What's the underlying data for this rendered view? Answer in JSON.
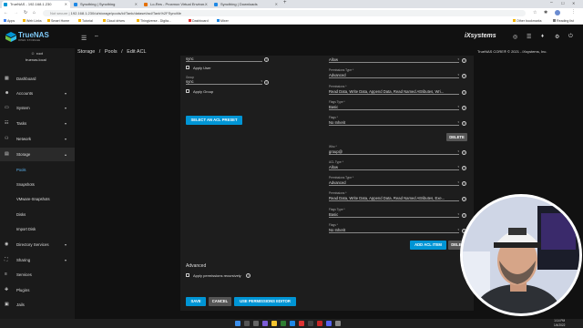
{
  "browser": {
    "tabs": [
      {
        "title": "TrueNAS - 192.168.1.230",
        "color": "#0095d5",
        "active": true
      },
      {
        "title": "Syncthing | Syncthing",
        "color": "#1e88e5",
        "active": false
      },
      {
        "title": "Lo-Res - Proxmox Virtual Environ...",
        "color": "#e57000",
        "active": false
      },
      {
        "title": "Syncthing | Downloads",
        "color": "#1e88e5",
        "active": false
      }
    ],
    "url_prefix": "Not secure",
    "url": "192.168.1.230/ui/storage/pools/id/Tank/dataset/acl/Tank%2FSyncMe",
    "bookmarks": [
      "Apps",
      "Web Links",
      "Smart Home",
      "Tutorial",
      "Cloud drives",
      "Thingiverse - Digita...",
      "Dashboard",
      "Mixer"
    ],
    "bookmarks_right": [
      "Other bookmarks",
      "Reading list"
    ]
  },
  "header": {
    "logo_text": "TrueNAS",
    "logo_sub": "OPEN STORAGE",
    "brand": "iXsystems"
  },
  "breadcrumb": {
    "items": [
      "Storage",
      "Pools",
      "Edit ACL"
    ],
    "separator": "/",
    "copyright": "TrueNAS CORE® © 2021 - iXsystems, Inc."
  },
  "sidebar": {
    "user": "root",
    "host": "truenas.local",
    "items": [
      {
        "label": "Dashboard",
        "icon": "dashboard-icon",
        "glyph": "▦",
        "chev": ""
      },
      {
        "label": "Accounts",
        "icon": "accounts-icon",
        "glyph": "☻",
        "chev": "▾"
      },
      {
        "label": "System",
        "icon": "system-icon",
        "glyph": "▭",
        "chev": "▾"
      },
      {
        "label": "Tasks",
        "icon": "tasks-icon",
        "glyph": "☷",
        "chev": "▾"
      },
      {
        "label": "Network",
        "icon": "network-icon",
        "glyph": "⚇",
        "chev": "▾"
      },
      {
        "label": "Storage",
        "icon": "storage-icon",
        "glyph": "▤",
        "chev": "▴"
      }
    ],
    "storage_sub": [
      "Pools",
      "Snapshots",
      "VMware-Snapshots",
      "Disks",
      "Import Disk"
    ],
    "items_after": [
      {
        "label": "Directory Services",
        "icon": "directory-services-icon",
        "glyph": "◉",
        "chev": "▾"
      },
      {
        "label": "Sharing",
        "icon": "sharing-icon",
        "glyph": "⛶",
        "chev": "▾"
      },
      {
        "label": "Services",
        "icon": "services-icon",
        "glyph": "≡",
        "chev": ""
      },
      {
        "label": "Plugins",
        "icon": "plugins-icon",
        "glyph": "✚",
        "chev": ""
      },
      {
        "label": "Jails",
        "icon": "jails-icon",
        "glyph": "▣",
        "chev": ""
      }
    ]
  },
  "form": {
    "left": {
      "user_value": "sync",
      "apply_user": "Apply User",
      "group_label": "Group",
      "group_value": "sync",
      "apply_group": "Apply Group",
      "select_preset": "SELECT AN ACL PRESET"
    },
    "entry1": {
      "type_value": "Allow",
      "perm_type_label": "Permissions Type *",
      "perm_type_value": "Advanced",
      "perms_label": "Permissions *",
      "perms_value": "Read Data, Write Data, Append Data, Read Named Attributes, Wri...",
      "flags_type_label": "Flags Type *",
      "flags_type_value": "Basic",
      "flags_label": "Flags *",
      "flags_value": "No Inherit",
      "delete": "DELETE"
    },
    "entry2": {
      "who_label": "Who *",
      "who_value": "group@",
      "acl_type_label": "ACL Type *",
      "acl_type_value": "Allow",
      "perm_type_label": "Permissions Type *",
      "perm_type_value": "Advanced",
      "perms_label": "Permissions *",
      "perms_value": "Read Data, Write Data, Append Data, Read Named Attributes, Exe...",
      "flags_type_label": "Flags Type *",
      "flags_type_value": "Basic",
      "flags_label": "Flags *",
      "flags_value": "No Inherit",
      "delete": "DELETE"
    },
    "add_acl_item": "ADD ACL ITEM",
    "advanced": "Advanced",
    "apply_recursive": "Apply permissions recursively",
    "save": "SAVE",
    "cancel": "CANCEL",
    "use_editor": "USE PERMISSIONS EDITOR"
  },
  "taskbar": {
    "time": "1:14 PM",
    "date": "1/4/2022"
  },
  "colors": {
    "accent": "#0095d5",
    "bg": "#111111",
    "card": "#1d1d1d",
    "active_link": "#5cb3f0"
  }
}
